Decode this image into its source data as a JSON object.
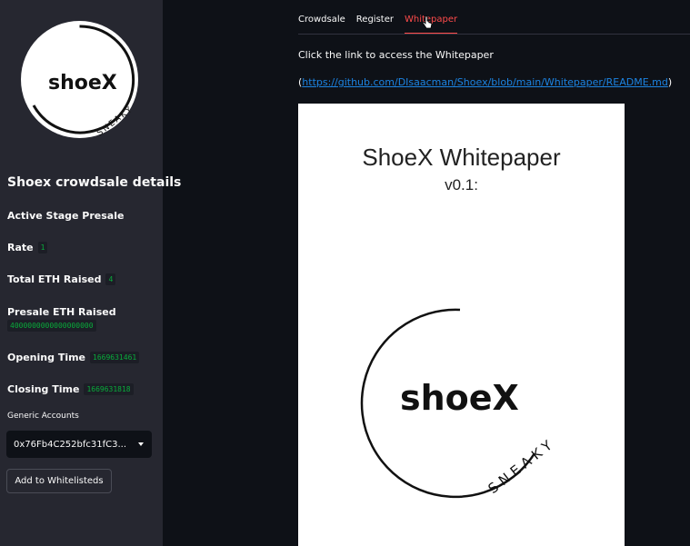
{
  "sidebar": {
    "logo": {
      "brand": "shoeX",
      "tagline": "SNEAKY"
    },
    "title": "Shoex crowdsale details",
    "active_stage": "Active Stage Presale",
    "rate": {
      "label": "Rate",
      "value": "1"
    },
    "total_eth": {
      "label": "Total ETH Raised",
      "value": "4"
    },
    "presale_eth": {
      "label": "Presale ETH Raised",
      "value": "4000000000000000000"
    },
    "opening_time": {
      "label": "Opening Time",
      "value": "1669631461"
    },
    "closing_time": {
      "label": "Closing Time",
      "value": "1669631818"
    },
    "accounts_label": "Generic Accounts",
    "account_selected": "0x76Fb4C252bfc31fC3...",
    "whitelist_button": "Add to Whitelisteds"
  },
  "tabs": [
    {
      "label": "Crowdsale",
      "active": false
    },
    {
      "label": "Register",
      "active": false
    },
    {
      "label": "Whitepaper",
      "active": true
    }
  ],
  "whitepaper": {
    "intro": "Click the link to access the Whitepaper",
    "link_open": "(",
    "link_url": "https://github.com/DIsaacman/Shoex/blob/main/Whitepaper/README.md",
    "link_close": ")",
    "doc_title": "ShoeX Whitepaper",
    "doc_version": "v0.1:",
    "doc_logo": {
      "brand": "shoeX",
      "tagline": "SNEAKY"
    }
  },
  "colors": {
    "sidebar_bg": "#262730",
    "main_bg": "#0e1117",
    "accent": "#ff4b4b",
    "code_green": "#09ab3b",
    "link": "#1c83e1"
  },
  "icons": [
    "shoex-logo",
    "chevron-down-icon",
    "hand-pointer-icon"
  ]
}
